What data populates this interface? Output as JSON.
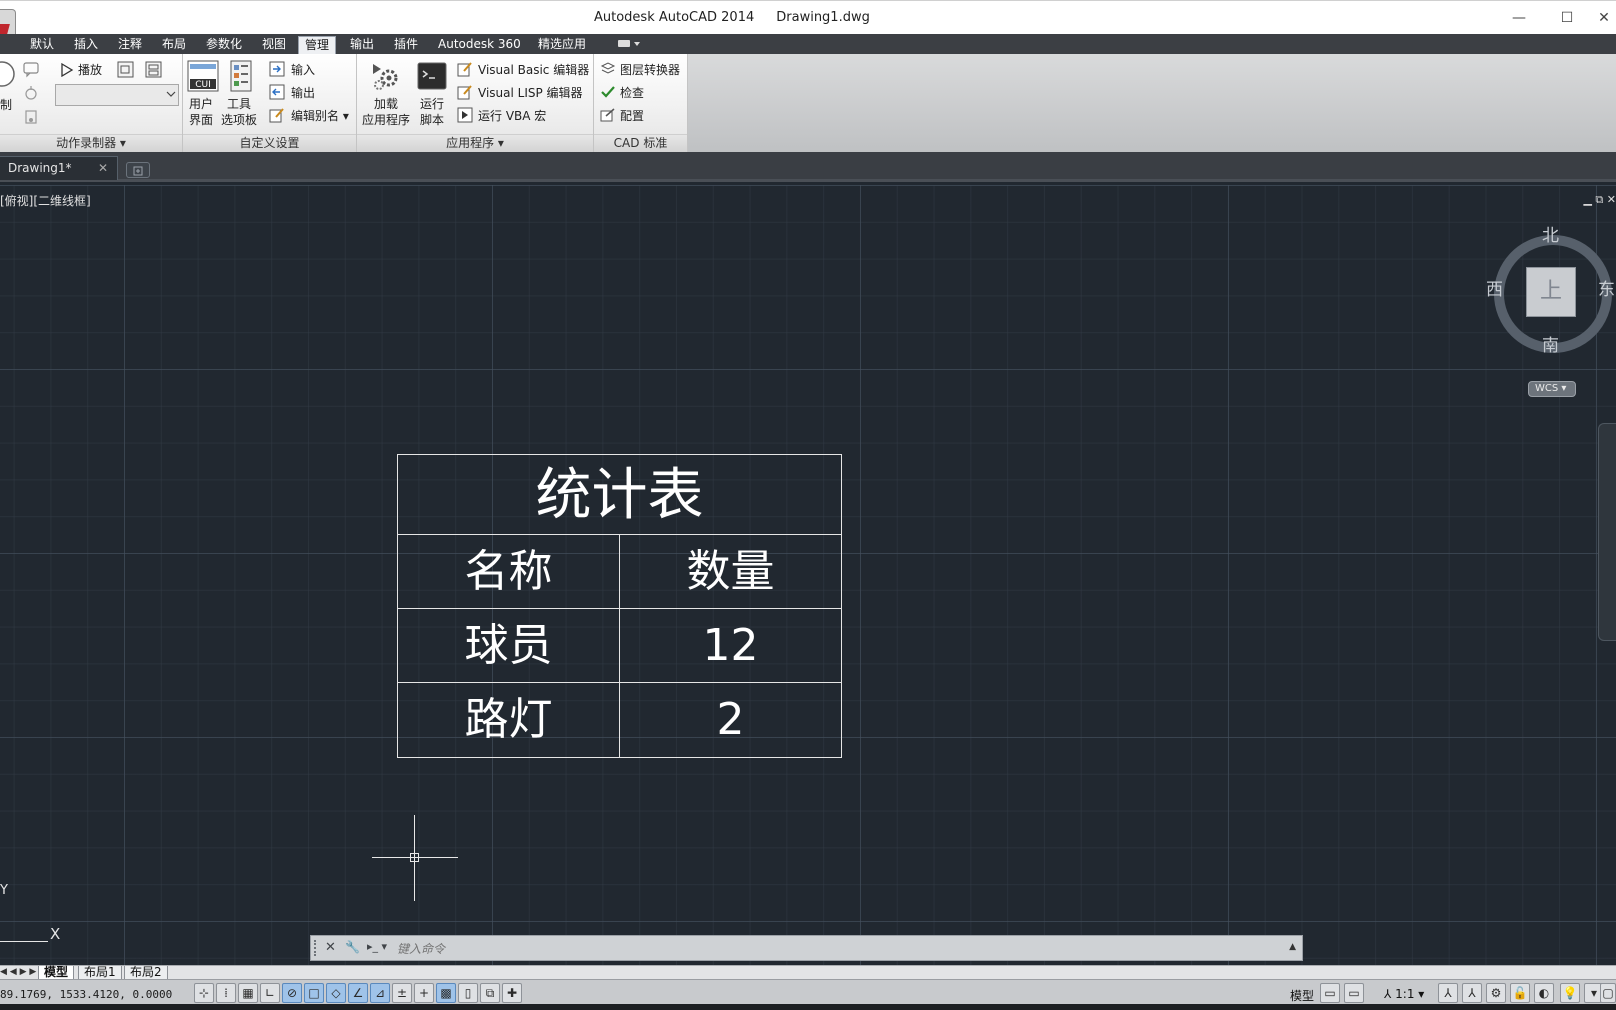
{
  "window": {
    "app_title": "Autodesk AutoCAD 2014",
    "file_name": "Drawing1.dwg",
    "minimize": "—",
    "maximize": "☐",
    "close": "✕"
  },
  "ribbon_tabs": [
    "默认",
    "插入",
    "注释",
    "布局",
    "参数化",
    "视图",
    "管理",
    "输出",
    "插件",
    "Autodesk 360",
    "精选应用"
  ],
  "active_ribbon_tab": "管理",
  "ribbon": {
    "action_recorder": {
      "title": "动作录制器 ▾",
      "record_label": "制",
      "play_label": "播放"
    },
    "customization": {
      "title": "自定义设置",
      "user_interface": [
        "用户",
        "界面"
      ],
      "tool_palettes": [
        "工具",
        "选项板"
      ],
      "cui_icon": "CUI",
      "import_label": "输入",
      "export_label": "输出",
      "edit_aliases_label": "编辑别名 ▾"
    },
    "applications": {
      "title": "应用程序 ▾",
      "load_app": [
        "加载",
        "应用程序"
      ],
      "run_script": [
        "运行",
        "脚本"
      ],
      "vb_editor": "Visual Basic 编辑器",
      "lisp_editor": "Visual LISP 编辑器",
      "run_vba": "运行 VBA 宏"
    },
    "cad_standards": {
      "title": "CAD 标准",
      "layer_translator": "图层转换器",
      "check": "检查",
      "configure": "配置"
    }
  },
  "document_tabs": [
    {
      "label": "Drawing1*",
      "close": "✕"
    }
  ],
  "viewport": {
    "view_label": "[俯视][二维线框]",
    "controls": "▁ ⧉ ✕"
  },
  "table": {
    "title": "统计表",
    "headers": [
      "名称",
      "数量"
    ],
    "rows": [
      [
        "球员",
        "12"
      ],
      [
        "路灯",
        "2"
      ]
    ]
  },
  "viewcube": {
    "north": "北",
    "south": "南",
    "west": "西",
    "east": "东",
    "face": "上",
    "wcs": "WCS ▾"
  },
  "ucs": {
    "x": "X",
    "y": "Y"
  },
  "command_line": {
    "placeholder": "键入命令",
    "close": "✕",
    "settings": "🔧",
    "prompt": "▸_ ▾"
  },
  "layout_tabs": {
    "nav": "◀ ◀ ▶ ▶",
    "tabs": [
      "模型",
      "布局1",
      "布局2"
    ],
    "active": "模型"
  },
  "status": {
    "coordinates": "89.1769, 1533.4120, 0.0000",
    "model_label": "模型",
    "scale": "⅄ 1:1 ▾"
  },
  "colors": {
    "canvas": "#212830",
    "ribbon_dark": "#3c3f44",
    "accent_on": "#9fc3e9"
  }
}
